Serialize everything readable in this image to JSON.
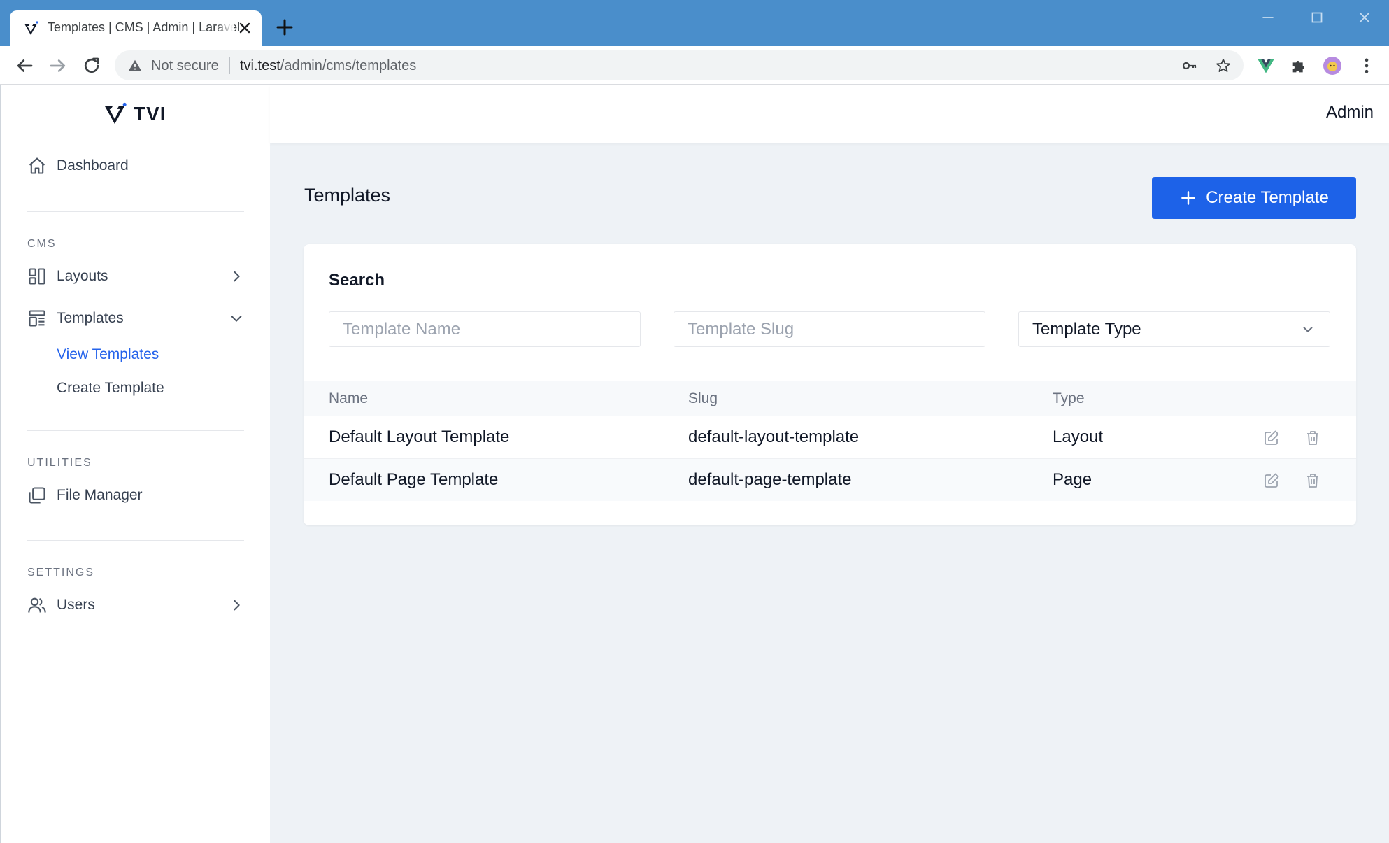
{
  "browser": {
    "tab_title": "Templates | CMS | Admin | Laravel",
    "security_label": "Not secure",
    "url_host": "tvi.test",
    "url_path": "/admin/cms/templates"
  },
  "brand": {
    "name": "TVI"
  },
  "header": {
    "user": "Admin"
  },
  "sidebar": {
    "dashboard": "Dashboard",
    "sections": {
      "cms": "CMS",
      "utilities": "UTILITIES",
      "settings": "SETTINGS"
    },
    "layouts": "Layouts",
    "templates": "Templates",
    "view_templates": "View Templates",
    "create_template": "Create Template",
    "file_manager": "File Manager",
    "users": "Users"
  },
  "page": {
    "title": "Templates",
    "create_button": "Create Template"
  },
  "search": {
    "title": "Search",
    "name_placeholder": "Template Name",
    "slug_placeholder": "Template Slug",
    "type_value": "Template Type"
  },
  "table": {
    "headers": [
      "Name",
      "Slug",
      "Type"
    ],
    "rows": [
      {
        "name": "Default Layout Template",
        "slug": "default-layout-template",
        "type": "Layout"
      },
      {
        "name": "Default Page Template",
        "slug": "default-page-template",
        "type": "Page"
      }
    ]
  },
  "colors": {
    "accent": "#1d62e8",
    "active_link": "#2563eb",
    "browser_frame": "#4a8ecb"
  }
}
